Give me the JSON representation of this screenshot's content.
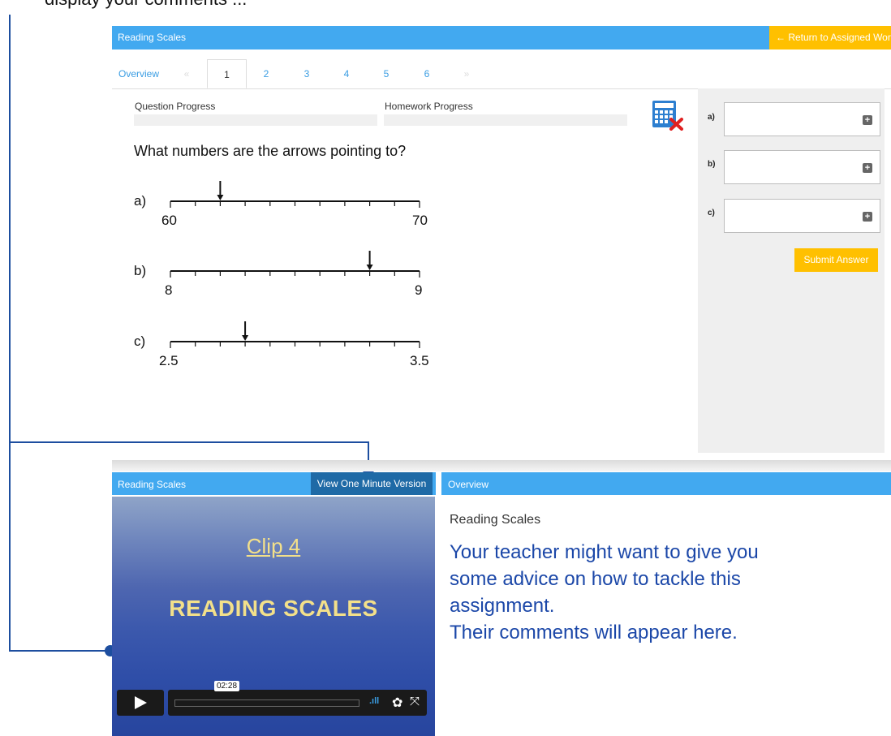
{
  "callout": {
    "text": "display your comments ..."
  },
  "topbar": {
    "title": "Reading Scales",
    "return_label": "← Return to Assigned Work"
  },
  "tabs": [
    {
      "label": "Overview"
    },
    {
      "label": "«"
    },
    {
      "label": "1"
    },
    {
      "label": "2"
    },
    {
      "label": "3"
    },
    {
      "label": "4"
    },
    {
      "label": "5"
    },
    {
      "label": "6"
    },
    {
      "label": "»"
    }
  ],
  "progress": {
    "question_label": "Question Progress",
    "homework_label": "Homework Progress"
  },
  "question": {
    "text": "What numbers are the arrows pointing to?",
    "lines": [
      {
        "label": "a)",
        "start": "60",
        "end": "70",
        "arrow_value": 62
      },
      {
        "label": "b)",
        "start": "8",
        "end": "9",
        "arrow_value": 8.8
      },
      {
        "label": "c)",
        "start": "2.5",
        "end": "3.5",
        "arrow_value": 2.8
      }
    ]
  },
  "answers": [
    {
      "label": "a)",
      "plus": "+"
    },
    {
      "label": "b)",
      "plus": "+"
    },
    {
      "label": "c)",
      "plus": "+"
    }
  ],
  "submit_label": "Submit Answer",
  "video": {
    "header_title": "Reading Scales",
    "one_minute_label": "View One Minute Version",
    "clip_title": "Clip 4",
    "clip_subtitle": "READING SCALES",
    "time": "02:28"
  },
  "overview": {
    "header_title": "Overview",
    "title": "Reading Scales",
    "lines": [
      "Your teacher might want to give you",
      "some advice on how to tackle this",
      "assignment.",
      "Their comments will appear here."
    ]
  }
}
